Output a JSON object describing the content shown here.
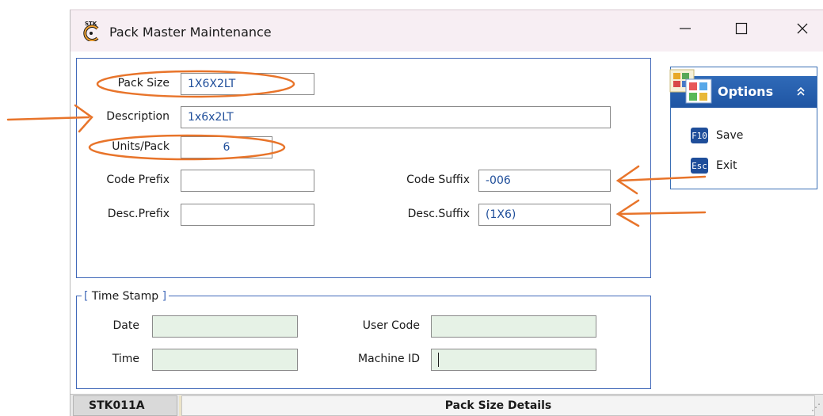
{
  "window": {
    "title": "Pack Master Maintenance",
    "controls": [
      "minimize-icon",
      "maximize-icon",
      "close-icon"
    ]
  },
  "form": {
    "pack_size": {
      "label": "Pack Size",
      "value": "1X6X2LT"
    },
    "description": {
      "label": "Description",
      "value": "1x6x2LT"
    },
    "units_pack": {
      "label": "Units/Pack",
      "value": "6"
    },
    "code_prefix": {
      "label": "Code Prefix",
      "value": ""
    },
    "code_suffix": {
      "label": "Code Suffix",
      "value": "-006"
    },
    "desc_prefix": {
      "label": "Desc.Prefix",
      "value": ""
    },
    "desc_suffix": {
      "label": "Desc.Suffix",
      "value": "(1X6)"
    }
  },
  "timestamp": {
    "legend": "Time Stamp",
    "date": {
      "label": "Date",
      "value": ""
    },
    "time": {
      "label": "Time",
      "value": ""
    },
    "user_code": {
      "label": "User Code",
      "value": ""
    },
    "machine_id": {
      "label": "Machine ID",
      "value": ""
    }
  },
  "options": {
    "title": "Options",
    "items": [
      {
        "key": "F10",
        "label": "Save"
      },
      {
        "key": "Esc",
        "label": "Exit"
      }
    ]
  },
  "status": {
    "code": "STK011A",
    "message": "Pack Size Details"
  },
  "colors": {
    "annotation": "#e8742a",
    "panel_border": "#4169b9",
    "field_text": "#1f4e9a",
    "readonly_fill": "#e6f2e6",
    "options_header": "#2f6ab8",
    "titlebar": "#f7eef3"
  }
}
